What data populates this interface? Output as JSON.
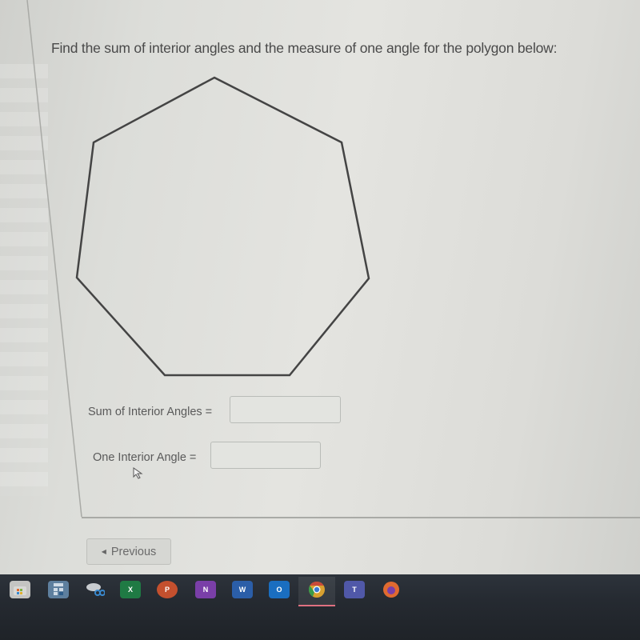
{
  "question": {
    "text": "Find the sum of interior angles and the measure of one angle for the polygon below:"
  },
  "figure": {
    "shape": "heptagon",
    "sides": 7,
    "stroke_color": "#444444"
  },
  "fields": {
    "sum": {
      "label": "Sum of Interior Angles =",
      "value": "",
      "placeholder": ""
    },
    "one": {
      "label": "One Interior Angle =",
      "value": "",
      "placeholder": ""
    }
  },
  "navigation": {
    "previous_label": "Previous",
    "previous_icon": "triangle-left"
  },
  "taskbar": {
    "apps": [
      {
        "name": "Microsoft Store",
        "icon": "store-icon",
        "glyph": "",
        "color": "#b8b8b8"
      },
      {
        "name": "Calculator",
        "icon": "calculator-icon",
        "glyph": "",
        "color": "#6b8aa8"
      },
      {
        "name": "Snipping Tool",
        "icon": "snipping-tool-icon",
        "glyph": "",
        "color": "#8fa0b0"
      },
      {
        "name": "Excel",
        "icon": "excel-icon",
        "glyph": "X",
        "color": "#1f7a44"
      },
      {
        "name": "PowerPoint",
        "icon": "powerpoint-icon",
        "glyph": "P",
        "color": "#c4502e"
      },
      {
        "name": "OneNote",
        "icon": "onenote-icon",
        "glyph": "N",
        "color": "#7a3fa8"
      },
      {
        "name": "Word",
        "icon": "word-icon",
        "glyph": "W",
        "color": "#2b5ea8"
      },
      {
        "name": "Outlook",
        "icon": "outlook-icon",
        "glyph": "O",
        "color": "#1a6ec0"
      },
      {
        "name": "Chrome",
        "icon": "chrome-icon",
        "glyph": "",
        "color": "#d8a030",
        "active": true
      },
      {
        "name": "Teams",
        "icon": "teams-icon",
        "glyph": "T",
        "color": "#5058a8"
      },
      {
        "name": "Firefox",
        "icon": "firefox-icon",
        "glyph": "",
        "color": "#e06a30"
      }
    ]
  }
}
